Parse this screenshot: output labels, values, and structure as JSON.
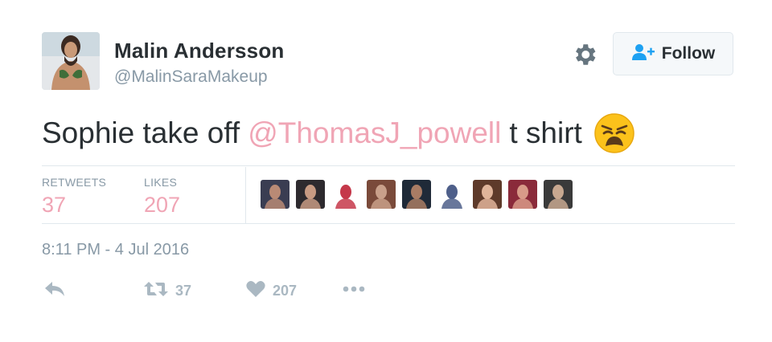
{
  "user": {
    "display_name": "Malin Andersson",
    "handle": "@MalinSaraMakeup"
  },
  "follow_button": {
    "label": "Follow"
  },
  "tweet": {
    "text_before": "Sophie take off",
    "mention": "@ThomasJ_powell",
    "text_after": "t shirt",
    "emoji": "weary-face"
  },
  "stats": {
    "retweets_label": "RETWEETS",
    "retweets_value": "37",
    "likes_label": "LIKES",
    "likes_value": "207"
  },
  "liker_avatars": [
    {
      "bg": "#3a3d52",
      "fg": "#b98a75"
    },
    {
      "bg": "#2d2a2e",
      "fg": "#c79a82"
    },
    {
      "bg": "#ffffff",
      "fg": "#c5384a"
    },
    {
      "bg": "#7a4a3a",
      "fg": "#c9a08a"
    },
    {
      "bg": "#1f2a38",
      "fg": "#a97c64"
    },
    {
      "bg": "#ffffff",
      "fg": "#4e5f8a"
    },
    {
      "bg": "#5e3a2a",
      "fg": "#e0b49a"
    },
    {
      "bg": "#8a2a3a",
      "fg": "#d89a88"
    },
    {
      "bg": "#3a3a3a",
      "fg": "#c8a890"
    }
  ],
  "timestamp": "8:11 PM - 4 Jul 2016",
  "actions": {
    "reply_icon": "reply-icon",
    "retweet_icon": "retweet-icon",
    "retweet_count": "37",
    "like_icon": "heart-icon",
    "like_count": "207",
    "more_icon": "more-icon"
  },
  "colors": {
    "mention": "#f0a5b5",
    "stat_value": "#f0a5b5",
    "muted": "#8899a6",
    "action": "#aab8c2",
    "text": "#292f33"
  }
}
